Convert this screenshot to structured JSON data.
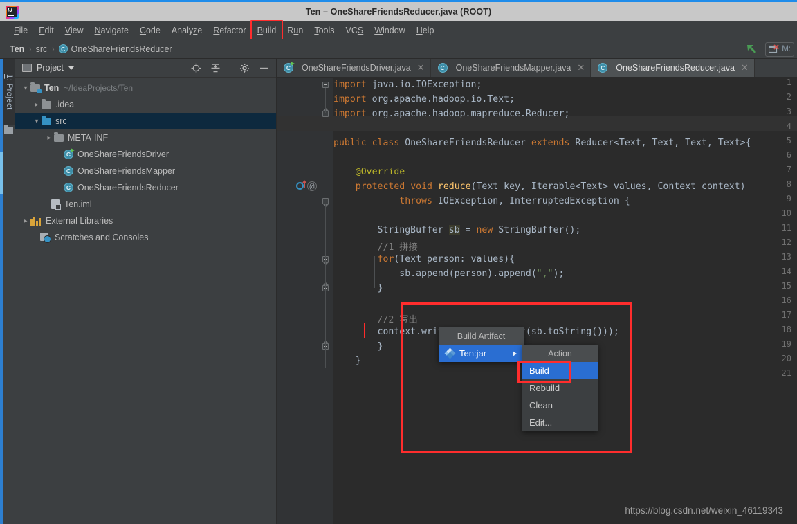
{
  "window": {
    "title": "Ten – OneShareFriendsReducer.java (ROOT)",
    "logo_icon": "intellij-idea-logo"
  },
  "menubar": {
    "items": [
      {
        "label": "File",
        "mnemonic": "F"
      },
      {
        "label": "Edit",
        "mnemonic": "E"
      },
      {
        "label": "View",
        "mnemonic": "V"
      },
      {
        "label": "Navigate",
        "mnemonic": "N"
      },
      {
        "label": "Code",
        "mnemonic": "C"
      },
      {
        "label": "Analyze",
        "mnemonic": "z"
      },
      {
        "label": "Refactor",
        "mnemonic": "R"
      },
      {
        "label": "Build",
        "mnemonic": "B",
        "highlighted": true
      },
      {
        "label": "Run",
        "mnemonic": "u"
      },
      {
        "label": "Tools",
        "mnemonic": "T"
      },
      {
        "label": "VCS",
        "mnemonic": "S"
      },
      {
        "label": "Window",
        "mnemonic": "W"
      },
      {
        "label": "Help",
        "mnemonic": "H"
      }
    ],
    "highlight_color": "#ff2d2d"
  },
  "navbar": {
    "crumbs": [
      "Ten",
      "src",
      "OneShareFriendsReducer"
    ],
    "separator": "›",
    "class_badge": "C",
    "run_icon": "run-green-arrow-icon",
    "right_box_label": "M:",
    "right_box_icon": "make-module-icon"
  },
  "toolstrip": {
    "tab_label": "1: Project",
    "tab_mnemonic": "1",
    "folder_icon": "folder-icon"
  },
  "project_panel": {
    "header_title": "Project",
    "header_icon": "project-view-icon",
    "caret_icon": "chevron-down-icon",
    "tools": [
      {
        "name": "locate-target-icon"
      },
      {
        "name": "collapse-all-icon"
      },
      {
        "name": "gear-icon"
      },
      {
        "name": "minimize-icon"
      }
    ],
    "tree": [
      {
        "label": "Ten",
        "note": "~/IdeaProjects/Ten",
        "icon": "module-folder-icon",
        "arrow": "expanded",
        "indent": 0,
        "bold": true,
        "selected": false
      },
      {
        "label": ".idea",
        "note": "",
        "icon": "folder-icon",
        "arrow": "collapsed",
        "indent": 1,
        "bold": false,
        "selected": false
      },
      {
        "label": "src",
        "note": "",
        "icon": "source-folder-icon",
        "arrow": "expanded",
        "indent": 1,
        "bold": false,
        "selected": true
      },
      {
        "label": "META-INF",
        "note": "",
        "icon": "folder-icon",
        "arrow": "collapsed",
        "indent": 2,
        "bold": false,
        "selected": false
      },
      {
        "label": "OneShareFriendsDriver",
        "note": "",
        "icon": "java-class-runnable-icon",
        "arrow": "none",
        "indent": 2,
        "bold": false,
        "selected": false
      },
      {
        "label": "OneShareFriendsMapper",
        "note": "",
        "icon": "java-class-icon",
        "arrow": "none",
        "indent": 2,
        "bold": false,
        "selected": false
      },
      {
        "label": "OneShareFriendsReducer",
        "note": "",
        "icon": "java-class-icon",
        "arrow": "none",
        "indent": 2,
        "bold": false,
        "selected": false
      },
      {
        "label": "Ten.iml",
        "note": "",
        "icon": "iml-file-icon",
        "arrow": "none",
        "indent": 1,
        "bold": false,
        "selected": false
      },
      {
        "label": "External Libraries",
        "note": "",
        "icon": "libraries-icon",
        "arrow": "collapsed",
        "indent": 0,
        "bold": false,
        "selected": false
      },
      {
        "label": "Scratches and Consoles",
        "note": "",
        "icon": "scratches-icon",
        "arrow": "none",
        "indent": 0,
        "bold": false,
        "selected": false
      }
    ]
  },
  "editor": {
    "tabs": [
      {
        "label": "OneShareFriendsDriver.java",
        "icon": "java-class-runnable-icon",
        "active": false,
        "close_icon": "close-icon"
      },
      {
        "label": "OneShareFriendsMapper.java",
        "icon": "java-class-icon",
        "active": false,
        "close_icon": "close-icon"
      },
      {
        "label": "OneShareFriendsReducer.java",
        "icon": "java-class-icon",
        "active": true,
        "close_icon": "close-icon"
      }
    ],
    "line_numbers": [
      "1",
      "2",
      "3",
      "4",
      "5",
      "6",
      "7",
      "8",
      "9",
      "10",
      "11",
      "12",
      "13",
      "14",
      "15",
      "16",
      "17",
      "18",
      "19",
      "20",
      "21"
    ],
    "lines": [
      {
        "n": 1,
        "text": "import java.io.IOException;"
      },
      {
        "n": 2,
        "text": "import org.apache.hadoop.io.Text;"
      },
      {
        "n": 3,
        "text": "import org.apache.hadoop.mapreduce.Reducer;"
      },
      {
        "n": 4,
        "text": ""
      },
      {
        "n": 5,
        "text": "public class OneShareFriendsReducer extends Reducer<Text, Text, Text, Text>{"
      },
      {
        "n": 6,
        "text": ""
      },
      {
        "n": 7,
        "text": "    @Override"
      },
      {
        "n": 8,
        "text": "    protected void reduce(Text key, Iterable<Text> values, Context context)"
      },
      {
        "n": 9,
        "text": "            throws IOException, InterruptedException {"
      },
      {
        "n": 10,
        "text": ""
      },
      {
        "n": 11,
        "text": "        StringBuffer sb = new StringBuffer();"
      },
      {
        "n": 12,
        "text": "        //1 拼接"
      },
      {
        "n": 13,
        "text": "        for(Text person: values){"
      },
      {
        "n": 14,
        "text": "            sb.append(person).append(\",\");"
      },
      {
        "n": 15,
        "text": "        }"
      },
      {
        "n": 16,
        "text": ""
      },
      {
        "n": 17,
        "text": "        //2 写出"
      },
      {
        "n": 18,
        "text": "        context.write(key, new Text(sb.toString()));"
      },
      {
        "n": 19,
        "text": "        }"
      },
      {
        "n": 20,
        "text": "    }"
      },
      {
        "n": 21,
        "text": ""
      }
    ],
    "gutter_icons": [
      {
        "line": 8,
        "name": "override-method-icon"
      },
      {
        "line": 8,
        "name": "annotation-at-icon"
      }
    ]
  },
  "popup_artifact": {
    "title": "Build Artifact",
    "items": [
      {
        "label": "Ten:jar",
        "icon": "artifact-jar-icon",
        "selected": true,
        "submenu_arrow": "chevron-right-icon"
      }
    ]
  },
  "popup_action": {
    "title": "Action",
    "items": [
      {
        "label": "Build",
        "selected": true,
        "highlighted": true
      },
      {
        "label": "Rebuild",
        "selected": false,
        "highlighted": false
      },
      {
        "label": "Clean",
        "selected": false,
        "highlighted": false
      },
      {
        "label": "Edit...",
        "selected": false,
        "highlighted": false
      }
    ]
  },
  "annotations": {
    "outer_redbox": "red-highlight-rect",
    "build_menu_redbox": "red-highlight-rect",
    "build_item_redbox": "red-highlight-rect"
  },
  "watermark": {
    "text": "https://blog.csdn.net/weixin_46119343"
  },
  "colors": {
    "accent_blue": "#2a6ed2",
    "highlight_red": "#ff2d2d",
    "selection_blue": "#0d293e",
    "editor_bg": "#2b2b2b",
    "panel_bg": "#3c3f41"
  }
}
